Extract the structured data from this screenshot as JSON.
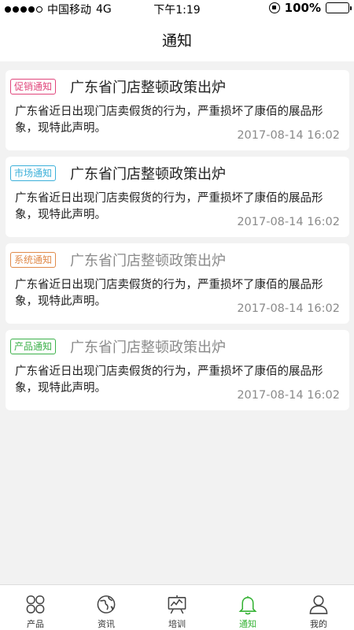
{
  "status_bar": {
    "carrier": "中国移动",
    "network": "4G",
    "time": "下午1:19",
    "battery": "100%"
  },
  "header": {
    "title": "通知"
  },
  "notifications": [
    {
      "tag": "促销通知",
      "tag_color": "#e0457b",
      "title": "广东省门店整顿政策出炉",
      "read": false,
      "body": "广东省近日出现门店卖假货的行为，严重损坏了康佰的展品形象，现特此声明。",
      "time": "2017-08-14 16:02"
    },
    {
      "tag": "市场通知",
      "tag_color": "#3bb0d9",
      "title": "广东省门店整顿政策出炉",
      "read": false,
      "body": "广东省近日出现门店卖假货的行为，严重损坏了康佰的展品形象，现特此声明。",
      "time": "2017-08-14 16:02"
    },
    {
      "tag": "系统通知",
      "tag_color": "#e08a4a",
      "title": "广东省门店整顿政策出炉",
      "read": true,
      "body": "广东省近日出现门店卖假货的行为，严重损坏了康佰的展品形象，现特此声明。",
      "time": "2017-08-14 16:02"
    },
    {
      "tag": "产品通知",
      "tag_color": "#3cb14a",
      "title": "广东省门店整顿政策出炉",
      "read": true,
      "body": "广东省近日出现门店卖假货的行为，严重损坏了康佰的展品形象，现特此声明。",
      "time": "2017-08-14 16:02"
    }
  ],
  "tab_bar": {
    "active_color": "#34b233",
    "tabs": [
      {
        "label": "产品",
        "icon": "grid-icon"
      },
      {
        "label": "资讯",
        "icon": "globe-icon"
      },
      {
        "label": "培训",
        "icon": "easel-icon"
      },
      {
        "label": "通知",
        "icon": "bell-icon",
        "active": true
      },
      {
        "label": "我的",
        "icon": "user-icon"
      }
    ]
  }
}
